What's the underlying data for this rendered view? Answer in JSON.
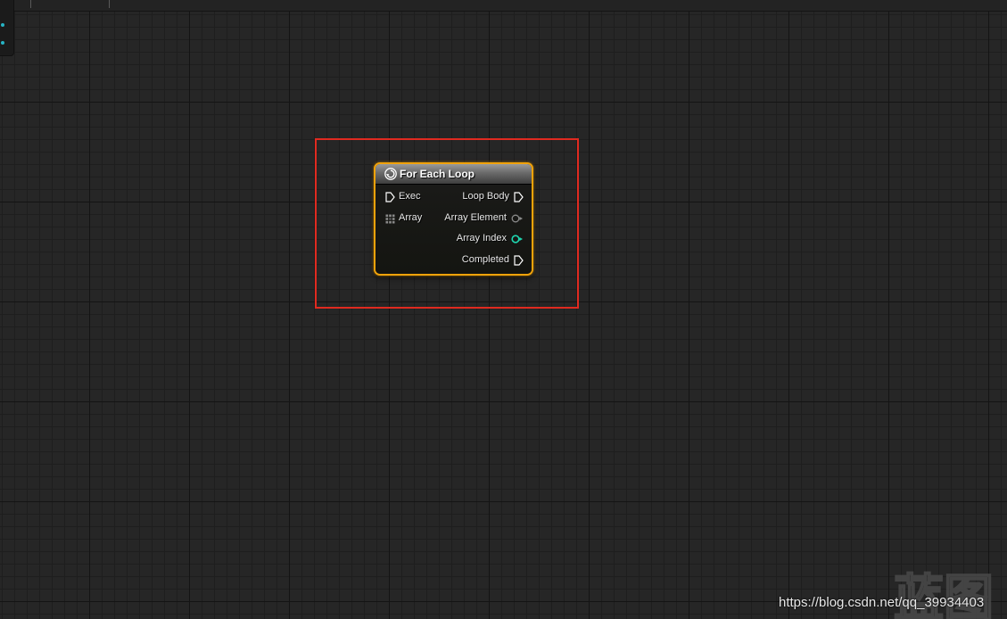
{
  "node": {
    "title": "For Each Loop",
    "border_color": "#f0a20a",
    "inputs": [
      {
        "label": "Exec",
        "pin": "exec-pin-icon"
      },
      {
        "label": "Array",
        "pin": "array-pin-icon"
      }
    ],
    "outputs": [
      {
        "label": "Loop Body",
        "pin": "exec-pin-icon"
      },
      {
        "label": "Array Element",
        "pin": "wildcard-pin-icon"
      },
      {
        "label": "Array Index",
        "pin": "integer-pin-icon"
      },
      {
        "label": "Completed",
        "pin": "exec-pin-icon"
      }
    ]
  },
  "highlight": {
    "color": "#e02a20"
  },
  "colors": {
    "integer_pin": "#1fd6b0",
    "wildcard_pin": "#8a8a8a",
    "exec_pin": "#ffffff"
  },
  "watermark": {
    "text": "https://blog.csdn.net/qq_39934403",
    "logo": "蓝图"
  }
}
